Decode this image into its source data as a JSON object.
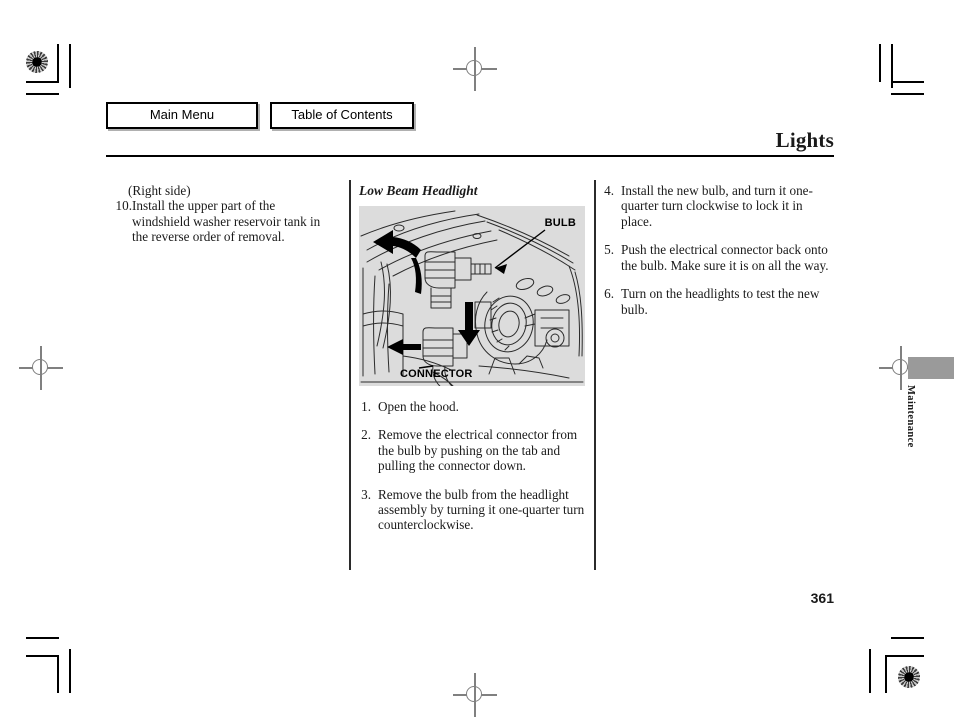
{
  "nav": {
    "main_menu": "Main Menu",
    "table_of_contents": "Table of Contents"
  },
  "header": {
    "title": "Lights"
  },
  "left_column": {
    "note": "(Right side)",
    "steps": [
      {
        "num": "10.",
        "text": "Install the upper part of the windshield washer reservoir tank in the reverse order of removal."
      }
    ]
  },
  "middle_column": {
    "subheading": "Low Beam Headlight",
    "figure": {
      "label_bulb": "BULB",
      "label_connector": "CONNECTOR",
      "background_color": "#dcdcdc"
    },
    "steps": [
      {
        "num": "1.",
        "text": "Open the hood."
      },
      {
        "num": "2.",
        "text": "Remove the electrical connector from the bulb by pushing on the tab and pulling the connector down."
      },
      {
        "num": "3.",
        "text": "Remove the bulb from the headlight assembly by turning it one-quarter turn counterclockwise."
      }
    ]
  },
  "right_column": {
    "steps": [
      {
        "num": "4.",
        "text": "Install the new bulb, and turn it one-quarter turn clockwise to lock it in place."
      },
      {
        "num": "5.",
        "text": "Push the electrical connector back onto the bulb. Make sure it is on all the way."
      },
      {
        "num": "6.",
        "text": "Turn on the headlights to test the new bulb."
      }
    ]
  },
  "side_tab": {
    "label": "Maintenance",
    "bar_color": "#9a9a9a"
  },
  "footer": {
    "page_number": "361"
  }
}
